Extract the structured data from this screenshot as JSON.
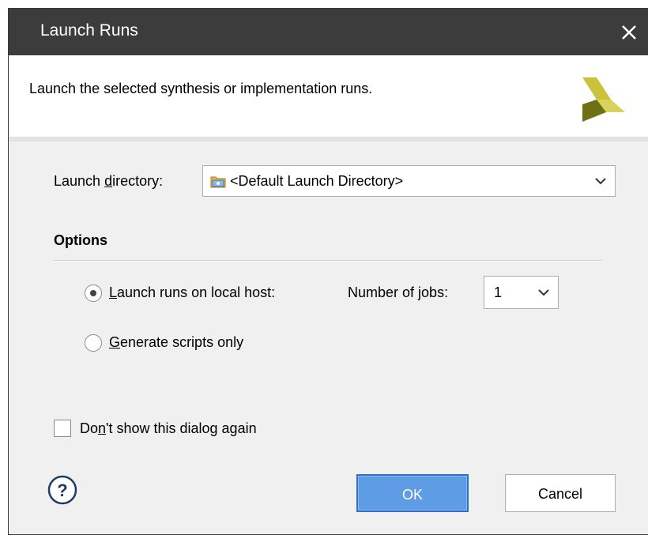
{
  "window": {
    "title": "Launch Runs",
    "close_icon": "close-icon"
  },
  "header": {
    "description": "Launch the selected synthesis or implementation runs.",
    "logo_icon": "xilinx-logo-icon",
    "logo_colors": [
      "#c9c23a",
      "#7a7a1a",
      "#5b5f12"
    ]
  },
  "launch_directory": {
    "label_prefix": "Launch ",
    "label_mnemonic": "d",
    "label_suffix": "irectory:",
    "value": "<Default Launch Directory>",
    "icon": "folder-icon"
  },
  "options": {
    "title": "Options",
    "local_host": {
      "mnemonic": "L",
      "label_rest": "aunch runs on local host:",
      "selected": true
    },
    "jobs": {
      "label_prefix": "Number of ",
      "label_mnemonic": "j",
      "label_suffix": "obs:",
      "value": "1"
    },
    "scripts_only": {
      "mnemonic": "G",
      "label_rest": "enerate scripts only",
      "selected": false
    }
  },
  "dont_show": {
    "label_prefix": "Do",
    "label_mnemonic": "n",
    "label_suffix": "'t show this dialog again",
    "checked": false
  },
  "buttons": {
    "ok": "OK",
    "cancel": "Cancel",
    "help_icon": "help-icon"
  },
  "colors": {
    "titlebar": "#3c3c3c",
    "dialog_bg": "#f0f0f0",
    "ok_button": "#5e9ce6"
  }
}
